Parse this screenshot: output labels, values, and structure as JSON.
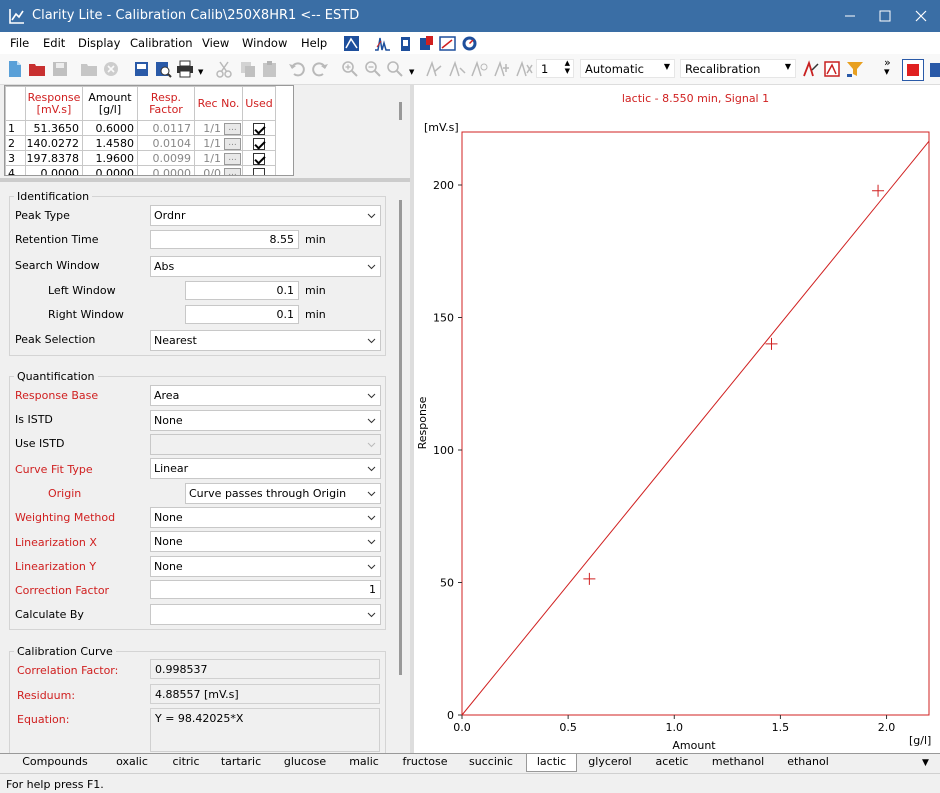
{
  "window": {
    "title": "Clarity Lite - Calibration Calib\\250X8HR1 <-- ESTD"
  },
  "menu": [
    "File",
    "Edit",
    "Display",
    "Calibration",
    "View",
    "Window",
    "Help"
  ],
  "toolbar": {
    "level_value": "1",
    "mode_value": "Automatic",
    "action_value": "Recalibration"
  },
  "table": {
    "headers": [
      {
        "label": "Response\n[mV.s]",
        "red": true
      },
      {
        "label": "Amount\n[g/l]",
        "red": false
      },
      {
        "label": "Resp.\nFactor",
        "red": true
      },
      {
        "label": "Rec No.",
        "red": true
      },
      {
        "label": "Used",
        "red": true
      }
    ],
    "rows": [
      {
        "n": "1",
        "response": "51.3650",
        "amount": "0.6000",
        "factor": "0.0117",
        "rec": "1/1",
        "used": true
      },
      {
        "n": "2",
        "response": "140.0272",
        "amount": "1.4580",
        "factor": "0.0104",
        "rec": "1/1",
        "used": true
      },
      {
        "n": "3",
        "response": "197.8378",
        "amount": "1.9600",
        "factor": "0.0099",
        "rec": "1/1",
        "used": true
      },
      {
        "n": "4",
        "response": "0.0000",
        "amount": "0.0000",
        "factor": "0.0000",
        "rec": "0/0",
        "used": false
      }
    ]
  },
  "identification": {
    "group": "Identification",
    "peak_type": {
      "label": "Peak Type",
      "value": "Ordnr"
    },
    "retention_time": {
      "label": "Retention Time",
      "value": "8.55",
      "unit": "min"
    },
    "search_window": {
      "label": "Search Window",
      "value": "Abs"
    },
    "left_window": {
      "label": "Left Window",
      "value": "0.1",
      "unit": "min"
    },
    "right_window": {
      "label": "Right Window",
      "value": "0.1",
      "unit": "min"
    },
    "peak_selection": {
      "label": "Peak Selection",
      "value": "Nearest"
    }
  },
  "quantification": {
    "group": "Quantification",
    "response_base": {
      "label": "Response Base",
      "value": "Area"
    },
    "is_istd": {
      "label": "Is ISTD",
      "value": "None"
    },
    "use_istd": {
      "label": "Use ISTD",
      "value": ""
    },
    "curve_fit_type": {
      "label": "Curve Fit Type",
      "value": "Linear"
    },
    "origin": {
      "label": "Origin",
      "value": "Curve passes through Origin"
    },
    "weighting_method": {
      "label": "Weighting Method",
      "value": "None"
    },
    "linearization_x": {
      "label": "Linearization X",
      "value": "None"
    },
    "linearization_y": {
      "label": "Linearization Y",
      "value": "None"
    },
    "correction_factor": {
      "label": "Correction Factor",
      "value": "1"
    },
    "calculate_by": {
      "label": "Calculate By",
      "value": ""
    }
  },
  "calibration_curve": {
    "group": "Calibration Curve",
    "correlation_factor": {
      "label": "Correlation Factor:",
      "value": "0.998537"
    },
    "residuum": {
      "label": "Residuum:",
      "value": "4.88557 [mV.s]"
    },
    "equation": {
      "label": "Equation:",
      "value": "Y = 98.42025*X"
    }
  },
  "chart_data": {
    "type": "scatter",
    "title": "lactic - 8.550 min, Signal 1",
    "xlabel": "Amount",
    "xunit": "[g/l]",
    "ylabel": "Response",
    "yunit": "[mV.s]",
    "xlim": [
      0,
      2.2
    ],
    "ylim": [
      0,
      220
    ],
    "xticks": [
      "0.0",
      "0.5",
      "1.0",
      "1.5",
      "2.0"
    ],
    "yticks": [
      "0",
      "50",
      "100",
      "150",
      "200"
    ],
    "points": [
      {
        "x": 0.6,
        "y": 51.365
      },
      {
        "x": 1.458,
        "y": 140.0272
      },
      {
        "x": 1.96,
        "y": 197.8378
      }
    ],
    "fit_line": {
      "slope": 98.42025,
      "intercept": 0
    },
    "color": "#d02020"
  },
  "tabs": [
    "Compounds",
    "oxalic",
    "citric",
    "tartaric",
    "glucose",
    "malic",
    "fructose",
    "succinic",
    "lactic",
    "glycerol",
    "acetic",
    "methanol",
    "ethanol"
  ],
  "active_tab": "lactic",
  "status": "For help press F1."
}
